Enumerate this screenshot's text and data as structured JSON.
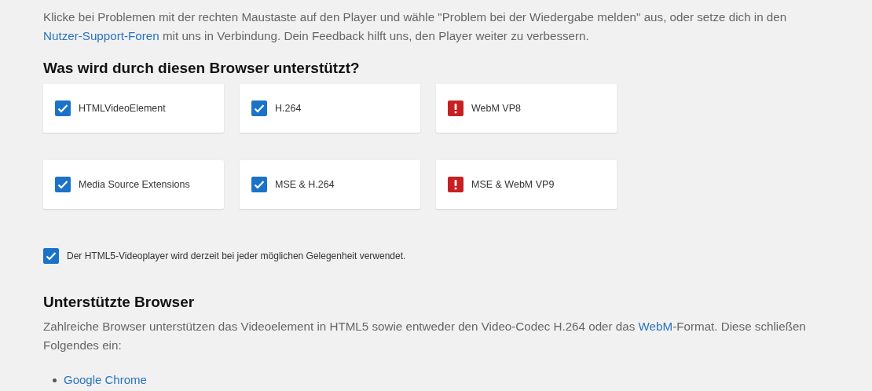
{
  "intro": [
    {
      "kind": "text",
      "text": "Klicke bei Problemen mit der rechten Maustaste auf den Player und wähle \"Problem bei der Wiedergabe melden\" aus, oder setze dich in den "
    },
    {
      "kind": "link",
      "text": "Nutzer-Support-Foren"
    },
    {
      "kind": "text",
      "text": " mit uns in Verbindung. Dein Feedback hilft uns, den Player weiter zu verbessern."
    }
  ],
  "support_heading": "Was wird durch diesen Browser unterstützt?",
  "features": [
    {
      "label": "HTMLVideoElement",
      "supported": true
    },
    {
      "label": "H.264",
      "supported": true
    },
    {
      "label": "WebM VP8",
      "supported": false
    },
    {
      "label": "Media Source Extensions",
      "supported": true
    },
    {
      "label": "MSE & H.264",
      "supported": true
    },
    {
      "label": "MSE & WebM VP9",
      "supported": false
    }
  ],
  "player_status": {
    "checked": true,
    "text": "Der HTML5-Videoplayer wird derzeit bei jeder möglichen Gelegenheit verwendet."
  },
  "browsers_heading": "Unterstützte Browser",
  "browsers_text": [
    {
      "kind": "text",
      "text": "Zahlreiche Browser unterstützen das Videoelement in HTML5 sowie entweder den Video-Codec H.264 oder das "
    },
    {
      "kind": "link",
      "text": "WebM"
    },
    {
      "kind": "text",
      "text": "-Format. Diese schließen Folgendes ein:"
    }
  ],
  "browsers": [
    "Google Chrome"
  ]
}
